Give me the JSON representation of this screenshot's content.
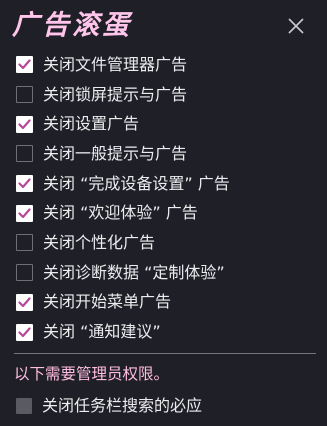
{
  "window": {
    "title": "广告滚蛋",
    "close_icon": "close-icon"
  },
  "options": [
    {
      "label": "关闭文件管理器广告",
      "checked": true
    },
    {
      "label": "关闭锁屏提示与广告",
      "checked": false
    },
    {
      "label": "关闭设置广告",
      "checked": true
    },
    {
      "label": "关闭一般提示与广告",
      "checked": false
    },
    {
      "label": "关闭 “完成设备设置” 广告",
      "checked": true
    },
    {
      "label": "关闭 “欢迎体验” 广告",
      "checked": true
    },
    {
      "label": "关闭个性化广告",
      "checked": false
    },
    {
      "label": "关闭诊断数据 “定制体验”",
      "checked": false
    },
    {
      "label": "关闭开始菜单广告",
      "checked": true
    },
    {
      "label": "关闭 “通知建议”",
      "checked": true
    }
  ],
  "admin_section": {
    "note": "以下需要管理员权限。",
    "options": [
      {
        "label": "关闭任务栏搜索的必应",
        "checked": false
      }
    ]
  },
  "colors": {
    "background": "#1f1f27",
    "title": "#ffc5ea",
    "checkmark": "#b5489a",
    "note": "#ffbde2"
  }
}
